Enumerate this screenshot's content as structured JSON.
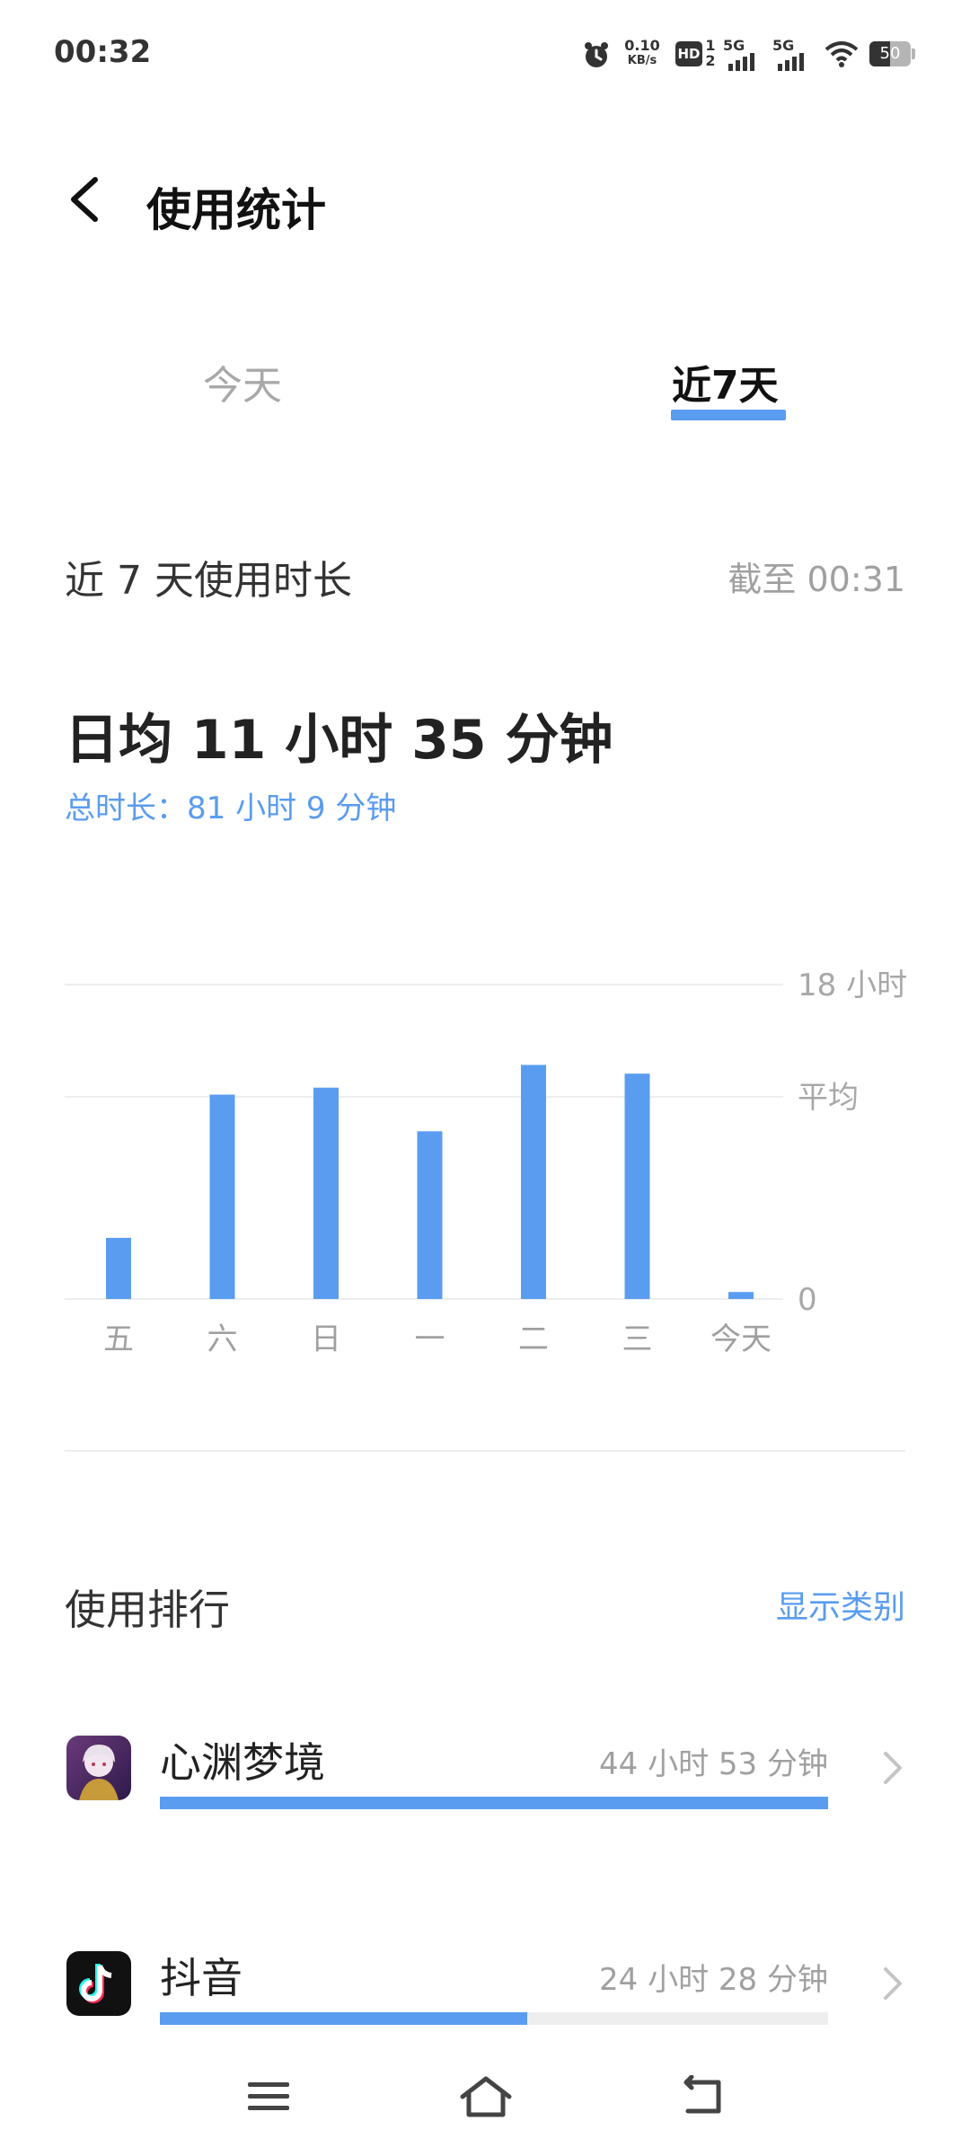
{
  "status": {
    "time": "00:32",
    "net_speed": "0.10",
    "net_unit": "KB/s",
    "hd": "HD",
    "sim1": "1",
    "sim2": "2",
    "net1": "5G",
    "net2": "5G",
    "battery": "50"
  },
  "header": {
    "title": "使用统计"
  },
  "tabs": [
    {
      "label": "今天",
      "active": false
    },
    {
      "label": "近7天",
      "active": true
    }
  ],
  "summary": {
    "section_title": "近 7 天使用时长",
    "cutoff": "截至 00:31",
    "daily_average": "日均 11 小时 35 分钟",
    "total": "总时长：81 小时 9 分钟"
  },
  "chart_data": {
    "type": "bar",
    "categories": [
      "五",
      "六",
      "日",
      "一",
      "二",
      "三",
      "今天"
    ],
    "values": [
      3.5,
      11.7,
      12.1,
      9.6,
      13.4,
      12.9,
      0.4
    ],
    "ylim": [
      0,
      18
    ],
    "y_tick_labels": {
      "top": "18 小时",
      "average": "平均",
      "bottom": "0"
    },
    "average": 11.58,
    "color": "#5a9cf0",
    "grid": true
  },
  "ranking": {
    "title": "使用排行",
    "action": "显示类别",
    "apps": [
      {
        "name": "心渊梦境",
        "time": "44 小时 53 分钟",
        "fraction": 1.0
      },
      {
        "name": "抖音",
        "time": "24 小时 28 分钟",
        "fraction": 0.55
      }
    ]
  },
  "icons": {
    "back": "chevron-left-icon",
    "alarm": "alarm-icon",
    "wifi": "wifi-icon",
    "battery": "battery-icon",
    "nav_menu": "menu-icon",
    "nav_home": "home-icon",
    "nav_back": "back-icon"
  }
}
